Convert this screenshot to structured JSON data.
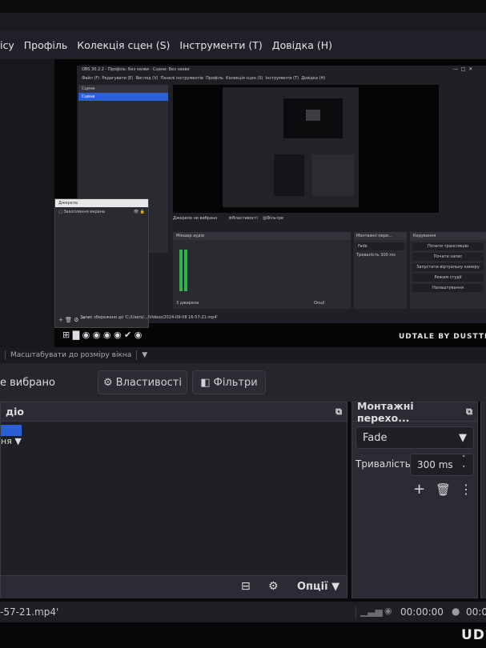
{
  "menu": [
    "ісу",
    "Профіль",
    "Колекція сцен (S)",
    "Інструменти (T)",
    "Довідка (H)"
  ],
  "preview": {
    "inner_title": "OBS 30.2.2 - Профіль: Без назви - Сцени: Без назви",
    "inner_menu": [
      "Файл (F)",
      "Редагувати (E)",
      "Вигляд (V)",
      "Панелі інструментів",
      "Профіль",
      "Колекція сцен (S)",
      "Інструменти (T)",
      "Довідка (H)"
    ],
    "scenes_title": "Сцени",
    "scene_name": "Сцена",
    "sources_title": "Джерела",
    "source_name": "Захоплення екрана",
    "no_source": "Джерело не вибрано",
    "properties": "Властивості",
    "filters": "Фільтри",
    "mixer": "Мікшер аудіо",
    "transitions": "Монтажні пере...",
    "controls": "Керування",
    "fade": "Fade",
    "duration_label": "Тривалість",
    "duration_value": "300 ms",
    "control_buttons": [
      "Почати трансляцію",
      "Почати запис",
      "Запустити віртуальну камеру",
      "Режим студії",
      "Налаштування"
    ],
    "taskbar_path": "Запис збережено до 'C:/Users/.../Videos/2024-09-08 16-57-21.mp4'",
    "watermark": "UDTALE BY DUSTTR",
    "scenes_count": "3 джерела",
    "options": "Опції"
  },
  "scale_bar": {
    "label": "Масштабувати до розміру вікна"
  },
  "context_bar": {
    "no_source": "е вибрано",
    "properties": "Властивості",
    "filters": "Фільтри"
  },
  "mixer_dock": {
    "title": "діо",
    "device_label": "ня",
    "options_label": "Опції"
  },
  "transitions_dock": {
    "title": "Монтажні перехо...",
    "transition": "Fade",
    "duration_label": "Тривалість",
    "duration_value": "300 ms"
  },
  "status_bar": {
    "file": "-57-21.mp4'",
    "stream_time": "00:00:00",
    "record_time": "00:0"
  },
  "colors": {
    "accent": "#2a5fd6",
    "panel": "#2b2c33",
    "background": "#0b0b0e"
  }
}
